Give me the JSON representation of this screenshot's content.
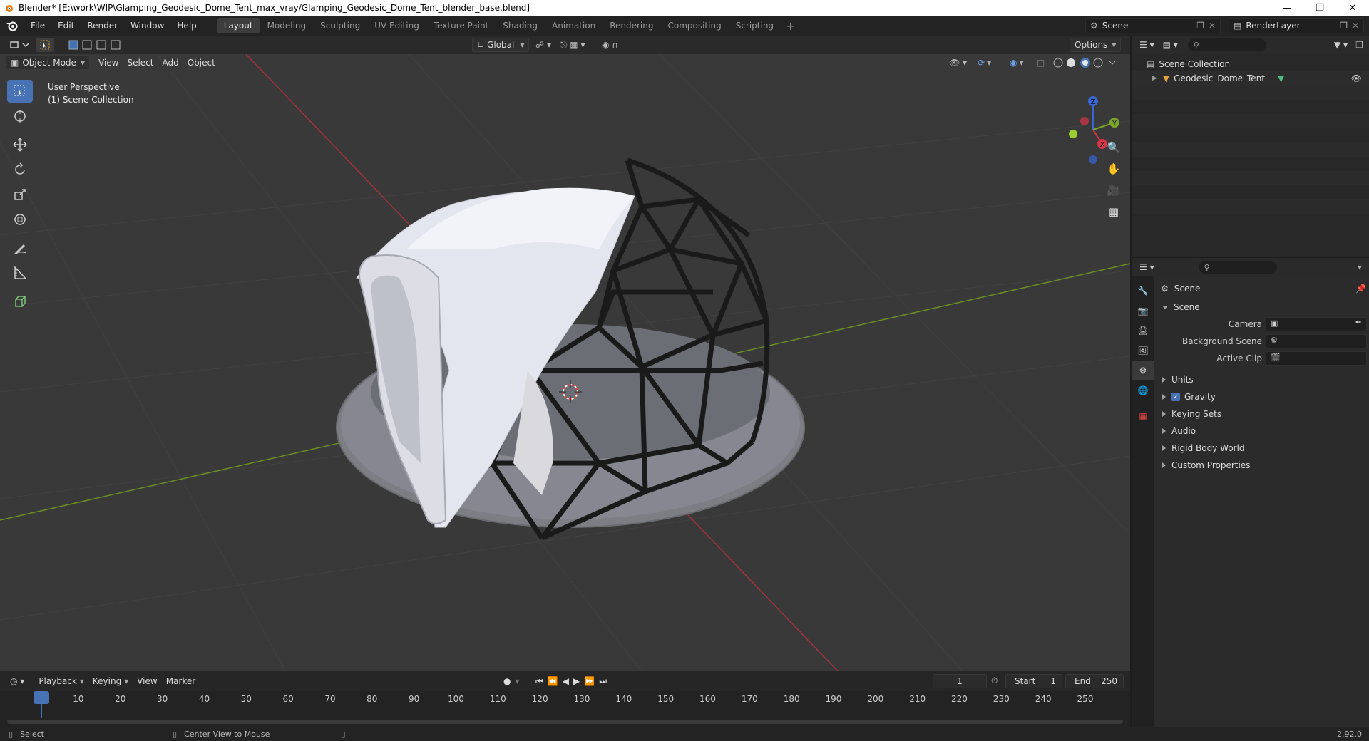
{
  "window": {
    "title": "Blender* [E:\\work\\WIP\\Glamping_Geodesic_Dome_Tent_max_vray/Glamping_Geodesic_Dome_Tent_blender_base.blend]"
  },
  "menu": [
    "File",
    "Edit",
    "Render",
    "Window",
    "Help"
  ],
  "workspaces": [
    {
      "label": "Layout",
      "active": true
    },
    {
      "label": "Modeling"
    },
    {
      "label": "Sculpting"
    },
    {
      "label": "UV Editing"
    },
    {
      "label": "Texture Paint"
    },
    {
      "label": "Shading"
    },
    {
      "label": "Animation"
    },
    {
      "label": "Rendering"
    },
    {
      "label": "Compositing"
    },
    {
      "label": "Scripting"
    }
  ],
  "scene_name": "Scene",
  "render_layer": "RenderLayer",
  "viewport": {
    "transform_orientation": "Global",
    "options_label": "Options",
    "mode": "Object Mode",
    "menus": [
      "View",
      "Select",
      "Add",
      "Object"
    ],
    "overlay_line1": "User Perspective",
    "overlay_line2": "(1) Scene Collection",
    "axes": {
      "x": "X",
      "y": "Y",
      "z": "Z"
    }
  },
  "outliner": {
    "root": "Scene Collection",
    "object": "Geodesic_Dome_Tent"
  },
  "properties": {
    "context": "Scene",
    "panel_title": "Scene",
    "fields": [
      {
        "label": "Camera"
      },
      {
        "label": "Background Scene"
      },
      {
        "label": "Active Clip"
      }
    ],
    "sections": [
      "Units",
      "Gravity",
      "Keying Sets",
      "Audio",
      "Rigid Body World",
      "Custom Properties"
    ]
  },
  "timeline": {
    "menus": [
      "Playback",
      "Keying",
      "View",
      "Marker"
    ],
    "current_frame": "1",
    "start_label": "Start",
    "start": "1",
    "end_label": "End",
    "end": "250",
    "ticks": [
      "1",
      "10",
      "20",
      "30",
      "40",
      "50",
      "60",
      "70",
      "80",
      "90",
      "100",
      "110",
      "120",
      "130",
      "140",
      "150",
      "160",
      "170",
      "180",
      "190",
      "200",
      "210",
      "220",
      "230",
      "240",
      "250"
    ]
  },
  "status": {
    "left": "Select",
    "middle": "Center View to Mouse",
    "version": "2.92.0"
  }
}
